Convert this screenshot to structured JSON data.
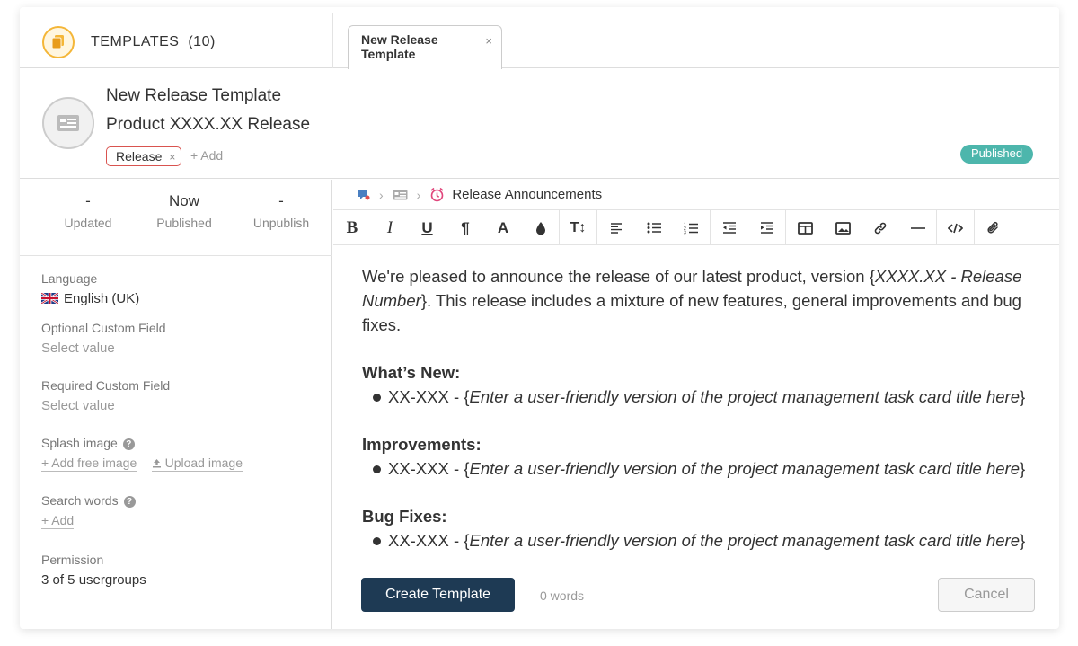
{
  "tabbar": {
    "templates_title": "TEMPLATES",
    "templates_count": "(10)",
    "open_tab_label": "New Release Template",
    "close_glyph": "×"
  },
  "header": {
    "name": "New Release Template",
    "title": "Product XXXX.XX Release",
    "tag": "Release",
    "tag_remove": "×",
    "add_tag": "+ Add",
    "status_badge": "Published",
    "status_color": "#4db6ac"
  },
  "stats": [
    {
      "value": "-",
      "label": "Updated"
    },
    {
      "value": "Now",
      "label": "Published"
    },
    {
      "value": "-",
      "label": "Unpublish"
    }
  ],
  "fields": {
    "language_label": "Language",
    "language_value": "English (UK)",
    "optional_label": "Optional Custom Field",
    "optional_value": "Select value",
    "required_label": "Required Custom Field",
    "required_value": "Select value",
    "splash_label": "Splash image",
    "splash_add_free": "+ Add free image",
    "splash_upload": "Upload image",
    "search_label": "Search words",
    "search_add": "+ Add",
    "permission_label": "Permission",
    "permission_value": "3 of 5 usergroups"
  },
  "breadcrumb": {
    "current": "Release Announcements"
  },
  "editor": {
    "intro_plain1": "We're pleased to announce the release of our latest product, version {",
    "intro_italic": "XXXX.XX - Release Number",
    "intro_plain2": "}. This release includes a mixture of new features, general improvements and bug fixes.",
    "sections": [
      {
        "heading": "What’s New:",
        "item_prefix": "XX-XXX - {",
        "item_italic": "Enter a user-friendly version of the project management task card title here",
        "item_suffix": "}"
      },
      {
        "heading": "Improvements:",
        "item_prefix": "XX-XXX - {",
        "item_italic": "Enter a user-friendly version of the project management task card title here",
        "item_suffix": "}"
      },
      {
        "heading": "Bug Fixes:",
        "item_prefix": "XX-XXX - {",
        "item_italic": "Enter a user-friendly version of the project management task card title here",
        "item_suffix": "}"
      }
    ]
  },
  "toolbar_icons": [
    "bold-icon",
    "italic-icon",
    "underline-icon",
    "paragraph-icon",
    "text-color-icon",
    "highlight-icon",
    "font-size-icon",
    "align-left-icon",
    "bullet-list-icon",
    "numbered-list-icon",
    "outdent-icon",
    "indent-icon",
    "table-icon",
    "image-icon",
    "link-icon",
    "horizontal-rule-icon",
    "code-icon",
    "attachment-icon"
  ],
  "footer": {
    "create_label": "Create Template",
    "word_count": "0 words",
    "cancel_label": "Cancel"
  }
}
